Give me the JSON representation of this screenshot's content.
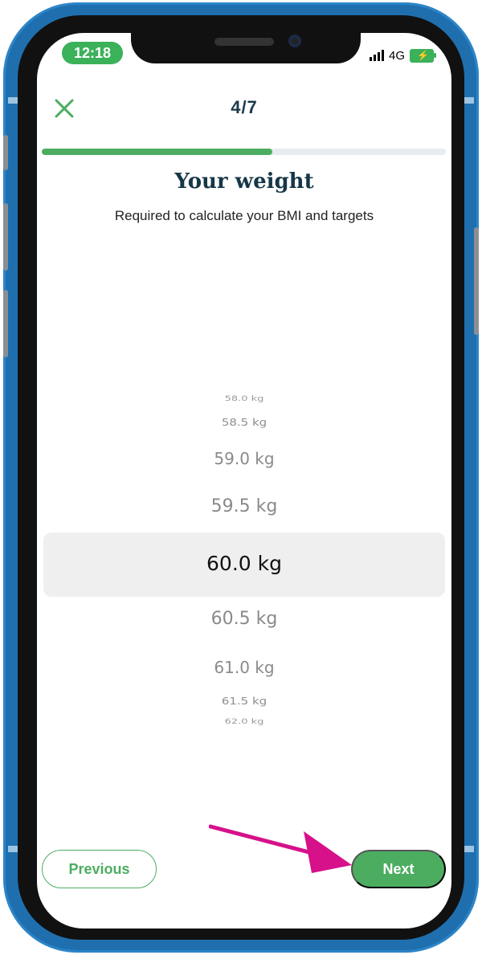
{
  "status_bar": {
    "time": "12:18",
    "network": "4G"
  },
  "header": {
    "step": "4/7",
    "close_icon": "close-icon"
  },
  "progress": {
    "fraction": 0.57
  },
  "page": {
    "title": "Your weight",
    "subtitle": "Required to calculate your BMI and targets"
  },
  "picker": {
    "items": [
      "58.0 kg",
      "58.5 kg",
      "59.0 kg",
      "59.5 kg",
      "60.0 kg",
      "60.5 kg",
      "61.0 kg",
      "61.5 kg",
      "62.0 kg"
    ],
    "selected": "60.0 kg"
  },
  "buttons": {
    "previous": "Previous",
    "next": "Next"
  },
  "colors": {
    "accent": "#4cad61",
    "title": "#163747",
    "annotation_arrow": "#d6118a"
  }
}
